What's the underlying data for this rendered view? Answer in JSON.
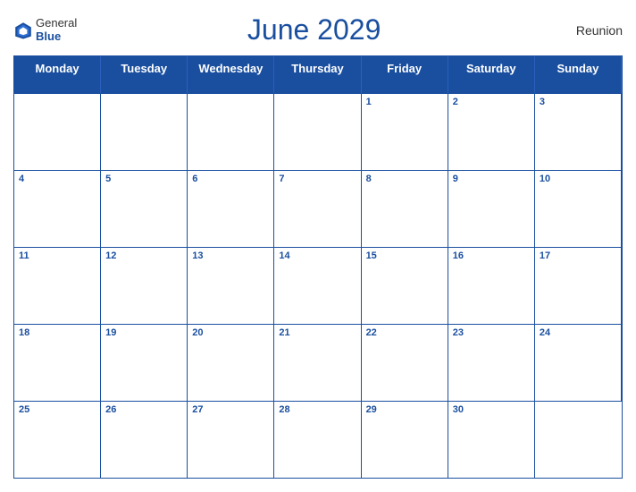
{
  "logo": {
    "general": "General",
    "blue": "Blue",
    "icon_color": "#1a4fa0"
  },
  "title": "June 2029",
  "region": "Reunion",
  "days_of_week": [
    "Monday",
    "Tuesday",
    "Wednesday",
    "Thursday",
    "Friday",
    "Saturday",
    "Sunday"
  ],
  "weeks": [
    [
      {
        "date": "",
        "empty": true
      },
      {
        "date": "",
        "empty": true
      },
      {
        "date": "",
        "empty": true
      },
      {
        "date": "",
        "empty": true
      },
      {
        "date": "1"
      },
      {
        "date": "2"
      },
      {
        "date": "3"
      }
    ],
    [
      {
        "date": "4"
      },
      {
        "date": "5"
      },
      {
        "date": "6"
      },
      {
        "date": "7"
      },
      {
        "date": "8"
      },
      {
        "date": "9"
      },
      {
        "date": "10"
      }
    ],
    [
      {
        "date": "11"
      },
      {
        "date": "12"
      },
      {
        "date": "13"
      },
      {
        "date": "14"
      },
      {
        "date": "15"
      },
      {
        "date": "16"
      },
      {
        "date": "17"
      }
    ],
    [
      {
        "date": "18"
      },
      {
        "date": "19"
      },
      {
        "date": "20"
      },
      {
        "date": "21"
      },
      {
        "date": "22"
      },
      {
        "date": "23"
      },
      {
        "date": "24"
      }
    ],
    [
      {
        "date": "25"
      },
      {
        "date": "26"
      },
      {
        "date": "27"
      },
      {
        "date": "28"
      },
      {
        "date": "29"
      },
      {
        "date": "30"
      },
      {
        "date": "",
        "empty": true
      }
    ]
  ]
}
